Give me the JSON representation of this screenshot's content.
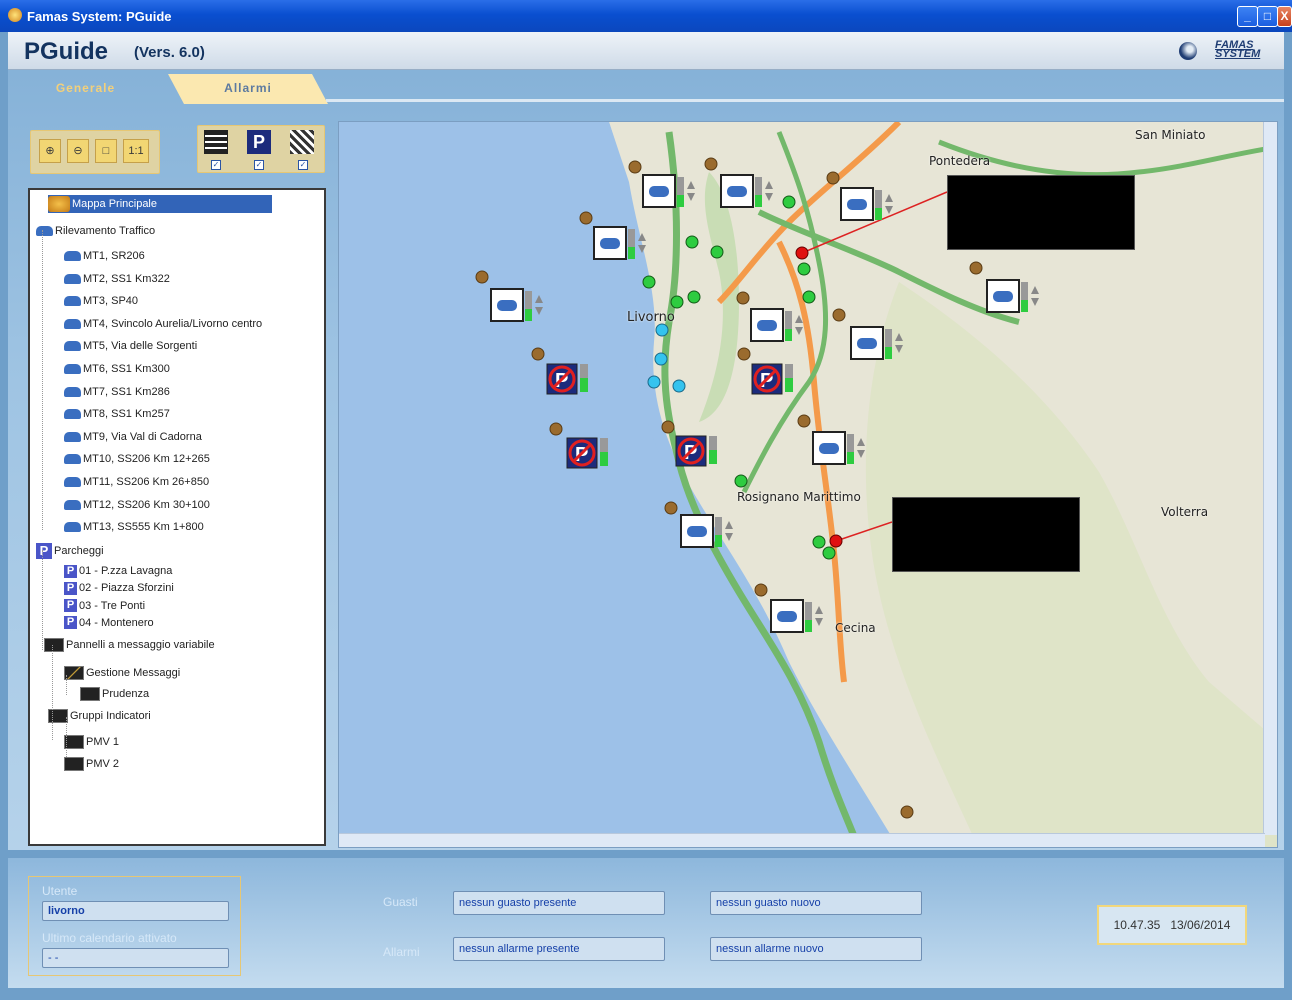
{
  "window": {
    "title": "Famas System: PGuide",
    "buttons": [
      "_",
      "□",
      "X"
    ]
  },
  "header": {
    "app_name": "PGuide",
    "version": "(Vers. 6.0)",
    "logo_text_1": "FAMAS",
    "logo_text_2": "SYSTEM"
  },
  "tabs": [
    {
      "label": "Generale"
    },
    {
      "label": "Allarmi"
    }
  ],
  "toolbar": {
    "zoom_in": "⊕",
    "zoom_out": "⊖",
    "fit": "□",
    "one_to_one": "1:1",
    "layers": [
      {
        "name": "pmv-layer",
        "checked": true
      },
      {
        "name": "parking-layer",
        "checked": true,
        "glyph": "P"
      },
      {
        "name": "traffic-layer",
        "checked": true
      }
    ]
  },
  "tree": {
    "root": "Mappa Principale",
    "traffic": {
      "label": "Rilevamento Traffico",
      "items": [
        "MT1, SR206",
        "MT2, SS1 Km322",
        "MT3, SP40",
        "MT4, Svincolo Aurelia/Livorno centro",
        "MT5, Via delle Sorgenti",
        "MT6, SS1 Km300",
        "MT7, SS1 Km286",
        "MT8, SS1 Km257",
        "MT9, Via Val di Cadorna",
        "MT10, SS206 Km 12+265",
        "MT11, SS206 Km 26+850",
        "MT12, SS206 Km 30+100",
        "MT13, SS555 Km 1+800"
      ]
    },
    "parking": {
      "label": "Parcheggi",
      "items": [
        "01 - P.zza Lavagna",
        "02 - Piazza Sforzini",
        "03 - Tre Ponti",
        "04 - Montenero"
      ]
    },
    "panels": {
      "label": "Pannelli a messaggio variabile",
      "messages": "Gestione Messaggi",
      "message_item": "Prudenza",
      "groups": "Gruppi Indicatori",
      "group_items": [
        "PMV 1",
        "PMV 2"
      ]
    }
  },
  "map": {
    "labels": {
      "san_miniato": "San Miniato",
      "pontedera": "Pontedera",
      "livorno": "Livorno",
      "rosignano": "Rosignano Marittimo",
      "volterra": "Volterra",
      "cecina": "Cecina"
    }
  },
  "footer": {
    "user_label": "Utente",
    "user_value": "livorno",
    "calendar_label": "Ultimo calendario attivato",
    "calendar_value": "- -",
    "faults_label": "Guasti",
    "alarms_label": "Allarmi",
    "faults_present": "nessun guasto presente",
    "faults_new": "nessun guasto nuovo",
    "alarms_present": "nessun allarme presente",
    "alarms_new": "nessun allarme nuovo",
    "time": "10.47.35",
    "date": "13/06/2014"
  }
}
